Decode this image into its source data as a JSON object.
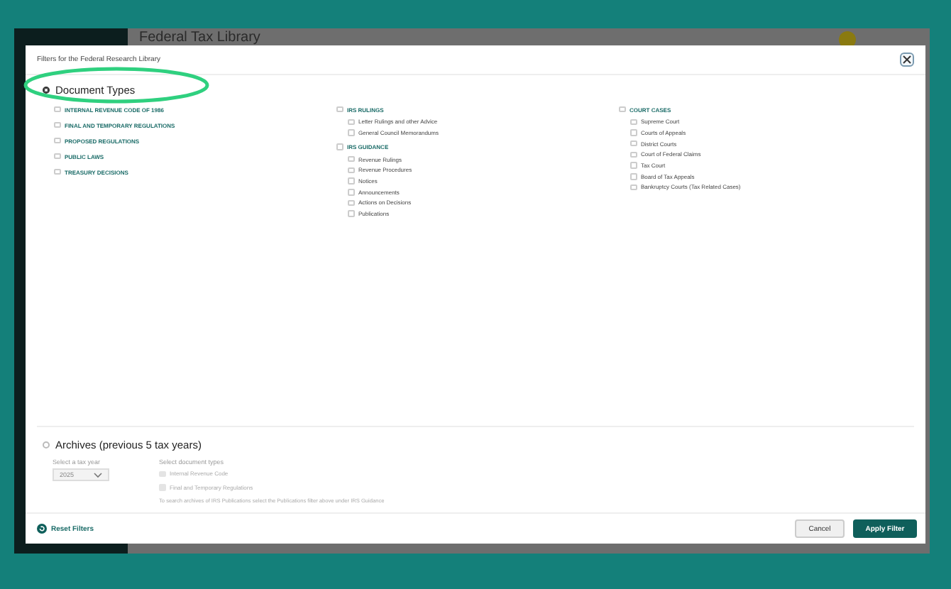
{
  "app": {
    "title": "Federal Tax Library"
  },
  "modal": {
    "title": "Filters for the Federal Research Library"
  },
  "document_types": {
    "label": "Document Types",
    "selected": true,
    "columns": [
      [
        {
          "label": "INTERNAL REVENUE CODE OF 1986",
          "checked": false
        },
        {
          "label": "FINAL AND TEMPORARY REGULATIONS",
          "checked": false
        },
        {
          "label": "PROPOSED REGULATIONS",
          "checked": false
        },
        {
          "label": "PUBLIC LAWS",
          "checked": false
        },
        {
          "label": "TREASURY DECISIONS",
          "checked": false
        }
      ],
      [
        {
          "label": "IRS RULINGS",
          "checked": false,
          "children": [
            {
              "label": "Letter Rulings and other Advice",
              "checked": false
            },
            {
              "label": "General Council Memorandums",
              "checked": false
            }
          ]
        },
        {
          "label": "IRS GUIDANCE",
          "checked": false,
          "children": [
            {
              "label": "Revenue Rulings",
              "checked": false
            },
            {
              "label": "Revenue Procedures",
              "checked": false
            },
            {
              "label": "Notices",
              "checked": false
            },
            {
              "label": "Announcements",
              "checked": false
            },
            {
              "label": "Actions on Decisions",
              "checked": false
            },
            {
              "label": "Publications",
              "checked": false
            }
          ]
        }
      ],
      [
        {
          "label": "COURT CASES",
          "checked": false,
          "children": [
            {
              "label": "Supreme Court",
              "checked": false
            },
            {
              "label": "Courts of Appeals",
              "checked": false
            },
            {
              "label": "District Courts",
              "checked": false
            },
            {
              "label": "Court of Federal Claims",
              "checked": false
            },
            {
              "label": "Tax Court",
              "checked": false
            },
            {
              "label": "Board of Tax Appeals",
              "checked": false
            },
            {
              "label": "Bankruptcy Courts (Tax Related Cases)",
              "checked": false
            }
          ]
        }
      ]
    ]
  },
  "archives": {
    "label": "Archives (previous 5 tax years)",
    "selected": false,
    "year_label": "Select a tax year",
    "year_value": "2025",
    "types_label": "Select document types",
    "types": [
      {
        "label": "Internal Revenue Code",
        "checked": false,
        "disabled": true
      },
      {
        "label": "Final and Temporary Regulations",
        "checked": false,
        "disabled": true
      }
    ],
    "note": "To search archives of IRS Publications select the Publications filter above under IRS Guidance"
  },
  "footer": {
    "reset": "Reset Filters",
    "cancel": "Cancel",
    "apply": "Apply Filter"
  }
}
